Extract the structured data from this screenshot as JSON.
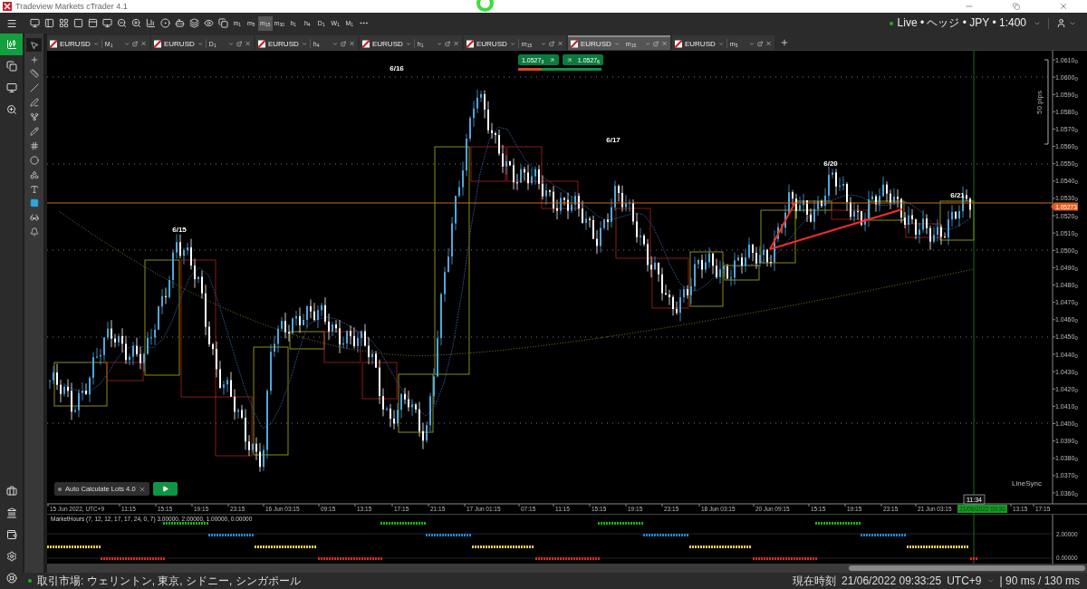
{
  "window": {
    "title": "Tradeview Markets cTrader 4.1"
  },
  "rail": [
    {
      "kind": "menu",
      "selected": false
    },
    {
      "kind": "chart",
      "selected": true
    },
    {
      "kind": "copy",
      "selected": false
    },
    {
      "kind": "monitor",
      "selected": false
    },
    {
      "kind": "search",
      "selected": false
    },
    {
      "kind": "briefcase",
      "selected": false
    },
    {
      "kind": "bank",
      "selected": false
    },
    {
      "kind": "wallet",
      "selected": false
    },
    {
      "kind": "settings",
      "selected": false
    },
    {
      "kind": "help",
      "selected": false
    }
  ],
  "toolbar": {
    "timeframes": [
      {
        "label": "m$_{1}$",
        "selected": false
      },
      {
        "label": "m$_{5}$",
        "selected": false
      },
      {
        "label": "m$_{15}$",
        "selected": true
      },
      {
        "label": "m$_{30}$",
        "selected": false
      },
      {
        "label": "h$_{1}$",
        "selected": false
      },
      {
        "label": "h$_{4}$",
        "selected": false
      },
      {
        "label": "D$_{1}$",
        "selected": false
      },
      {
        "label": "W$_{1}$",
        "selected": false
      },
      {
        "label": "M$_{1}$",
        "selected": false
      }
    ],
    "account": "Live • ヘッジ • JPY • 1:400"
  },
  "tools": [
    {
      "kind": "pointer",
      "selected": true
    },
    {
      "kind": "crosshair",
      "selected": false
    },
    {
      "kind": "ruler",
      "selected": false
    },
    {
      "kind": "line",
      "selected": false
    },
    {
      "kind": "pen",
      "selected": false
    },
    {
      "kind": "fork",
      "selected": false
    },
    {
      "kind": "pencil",
      "selected": false
    },
    {
      "kind": "grid",
      "selected": false
    },
    {
      "kind": "ellipse",
      "selected": false
    },
    {
      "kind": "shapes",
      "selected": false
    },
    {
      "kind": "text",
      "selected": false
    },
    {
      "kind": "color",
      "selected": false
    },
    {
      "kind": "glasses",
      "selected": false
    },
    {
      "kind": "bell",
      "selected": false
    }
  ],
  "tabs": [
    {
      "symbol": "EURUSD",
      "timeframe": "M$_{1}$",
      "selected": false
    },
    {
      "symbol": "EURUSD",
      "timeframe": "D$_{1}$",
      "selected": false
    },
    {
      "symbol": "EURUSD",
      "timeframe": "h$_{4}$",
      "selected": false
    },
    {
      "symbol": "EURUSD",
      "timeframe": "h$_{1}$",
      "selected": false
    },
    {
      "symbol": "EURUSD",
      "timeframe": "m$_{15}$",
      "selected": false
    },
    {
      "symbol": "EURUSD",
      "timeframe": "m$_{15}$",
      "selected": true
    },
    {
      "symbol": "EURUSD",
      "timeframe": "m$_{5}$",
      "selected": false
    }
  ],
  "chart": {
    "trade_buttons": [
      {
        "kind": "sell",
        "price": "1.0527$_{3}$"
      },
      {
        "kind": "buy",
        "price": "1.0527$_{6}$"
      }
    ],
    "sentiment": {
      "level": 0.28
    },
    "date_labels": [
      "6/16",
      "6/17",
      "6/15",
      "6/20",
      "6/21"
    ],
    "range_label": "50 pips",
    "linesync_label": "LineSync",
    "price_ticks": [
      {
        "price": "1.0610",
        "pipette": "0"
      },
      {
        "price": "1.0600",
        "pipette": "0"
      },
      {
        "price": "1.0590",
        "pipette": "0"
      },
      {
        "price": "1.0580",
        "pipette": "0"
      },
      {
        "price": "1.0570",
        "pipette": "0"
      },
      {
        "price": "1.0560",
        "pipette": "0"
      },
      {
        "price": "1.0550",
        "pipette": "0"
      },
      {
        "price": "1.0540",
        "pipette": "0"
      },
      {
        "price": "1.0530",
        "pipette": "0"
      },
      {
        "price": "1.0520",
        "pipette": "0"
      },
      {
        "price": "1.0510",
        "pipette": "0"
      },
      {
        "price": "1.0500",
        "pipette": "0"
      },
      {
        "price": "1.0490",
        "pipette": "0"
      },
      {
        "price": "1.0480",
        "pipette": "0"
      },
      {
        "price": "1.0470",
        "pipette": "0"
      },
      {
        "price": "1.0460",
        "pipette": "0"
      },
      {
        "price": "1.0450",
        "pipette": "0"
      },
      {
        "price": "1.0440",
        "pipette": "0"
      },
      {
        "price": "1.0430",
        "pipette": "0"
      },
      {
        "price": "1.0420",
        "pipette": "0"
      },
      {
        "price": "1.0410",
        "pipette": "0"
      },
      {
        "price": "1.0400",
        "pipette": "0"
      },
      {
        "price": "1.0390",
        "pipette": "0"
      },
      {
        "price": "1.0380",
        "pipette": "0"
      },
      {
        "price": "1.0370",
        "pipette": "0"
      },
      {
        "price": "1.0360",
        "pipette": "0"
      }
    ],
    "current_price": "1.05273",
    "time_labels": [
      "15 Jun 2022, UTC+9",
      "11:15",
      "15:15",
      "19:15",
      "23:15",
      "16 Jun 03:15",
      "09:15",
      "13:15",
      "17:15",
      "21:15",
      "17 Jun 01:15",
      "07:15",
      "11:15",
      "15:15",
      "19:15",
      "23:15",
      "18 Jun 03:15",
      "20 Jun 09:15",
      "15:15",
      "19:15",
      "23:15",
      "21 Jun 03:15",
      "13:15",
      "17:15"
    ],
    "time_badge": "21/06/2022 09:30",
    "cursor_time": "11:34",
    "bot": {
      "name": "Auto Calculate Lots 4.0"
    }
  },
  "indicator": {
    "title": "MarketHours (7, 12, 12, 17, 17, 24, 0, 7) 3.00000, 2.00000, 1.00000, 0.00000",
    "ticks": [
      "2.00000",
      "0.00000"
    ],
    "sessions": [
      {
        "color": "#1fb51f"
      },
      {
        "color": "#1e88d8"
      },
      {
        "color": "#f2d14a"
      },
      {
        "color": "#e02828"
      }
    ]
  },
  "status_bar": {
    "markets": "取引市場: ウェリントン, 東京, シドニー, シンガポール",
    "time_label": "現在時刻",
    "time": "21/06/2022 09:33:25",
    "timezone": "UTC+9",
    "latency": "| 90 ms / 130 ms"
  }
}
